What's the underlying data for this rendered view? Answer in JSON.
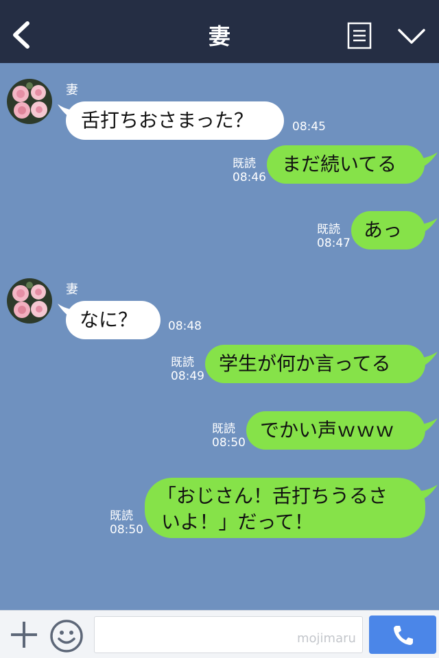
{
  "header": {
    "title": "妻"
  },
  "messages": [
    {
      "sender": "妻",
      "text": "舌打ちおさまった？",
      "time": "08:45"
    },
    {
      "text": "まだ続いてる",
      "read": "既読",
      "time": "08:46"
    },
    {
      "text": "あっ",
      "read": "既読",
      "time": "08:47"
    },
    {
      "sender": "妻",
      "text": "なに？",
      "time": "08:48"
    },
    {
      "text": "学生が何か言ってる",
      "read": "既読",
      "time": "08:49"
    },
    {
      "text": "でかい声ｗｗｗ",
      "read": "既読",
      "time": "08:50"
    },
    {
      "text_line1": "「おじさん！舌打ちうるさ",
      "text_line2": "いよ！」だって！",
      "read": "既読",
      "time": "08:50"
    }
  ],
  "footer": {
    "input_value": "",
    "watermark": "mojimaru"
  },
  "colors": {
    "header_bg": "#252e44",
    "chat_bg": "#6f91bf",
    "out_bubble": "#86e249",
    "call_button": "#4b86e8"
  }
}
